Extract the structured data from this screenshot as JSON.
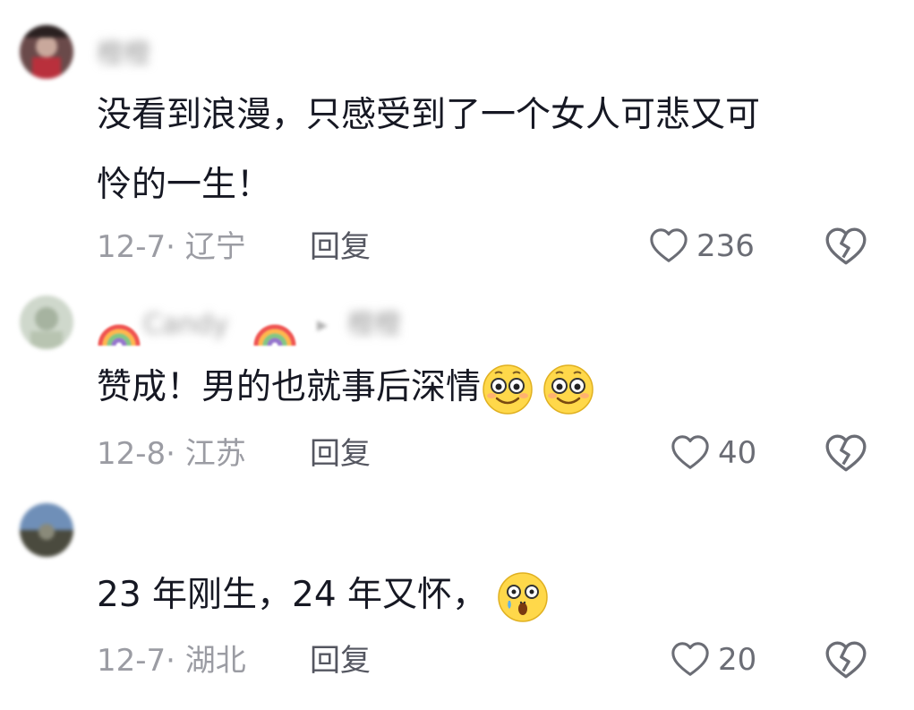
{
  "comments": [
    {
      "username": "橙橙",
      "text_lines": [
        "没看到浪漫，只感受到了一个女人可悲又可",
        "怜的一生！"
      ],
      "date_location": "12-7· 辽宁",
      "reply_label": "回复",
      "likes": "236",
      "avatar_icon": "user-avatar-icon"
    },
    {
      "username": "Candy",
      "reply_to": "橙橙",
      "text": "赞成！男的也就事后深情",
      "emojis": [
        "smile-emoji-icon",
        "smile-emoji-icon"
      ],
      "date_location": "12-8· 江苏",
      "reply_label": "回复",
      "likes": "40",
      "avatar_icon": "user-avatar-icon"
    },
    {
      "username": "",
      "text": "23 年刚生，24 年又怀，",
      "emojis": [
        "shocked-emoji-icon"
      ],
      "date_location": "12-7· 湖北",
      "reply_label": "回复",
      "likes": "20",
      "avatar_icon": "user-avatar-icon"
    }
  ]
}
